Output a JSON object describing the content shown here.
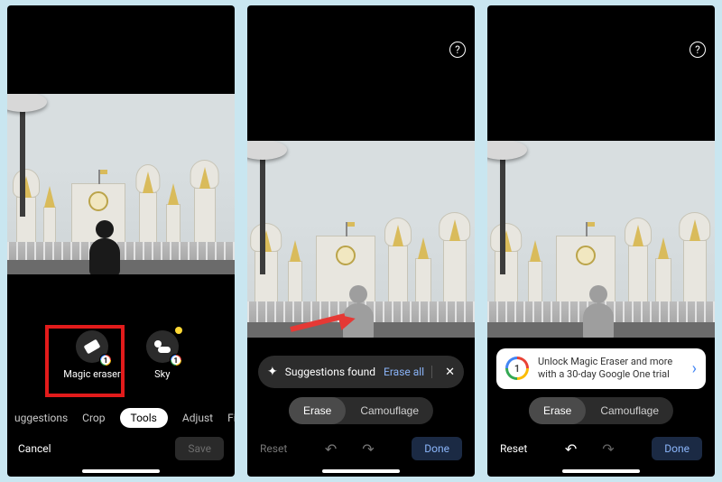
{
  "screen1": {
    "tools": {
      "magic_eraser": {
        "label": "Magic eraser",
        "badge": "1"
      },
      "sky": {
        "label": "Sky",
        "badge": "1"
      }
    },
    "tabs": {
      "suggestions": "uggestions",
      "crop": "Crop",
      "tools": "Tools",
      "adjust": "Adjust",
      "filters": "Filters"
    },
    "cancel": "Cancel",
    "save": "Save"
  },
  "screen2": {
    "help": "?",
    "suggestions_label": "Suggestions found",
    "erase_all": "Erase all",
    "close": "✕",
    "seg": {
      "erase": "Erase",
      "camouflage": "Camouflage"
    },
    "reset": "Reset",
    "undo": "↶",
    "redo": "↷",
    "done": "Done"
  },
  "screen3": {
    "help": "?",
    "unlock": {
      "badge": "1",
      "text": "Unlock Magic Eraser and more with a 30-day Google One trial"
    },
    "seg": {
      "erase": "Erase",
      "camouflage": "Camouflage"
    },
    "reset": "Reset",
    "undo": "↶",
    "redo": "↷",
    "done": "Done"
  }
}
